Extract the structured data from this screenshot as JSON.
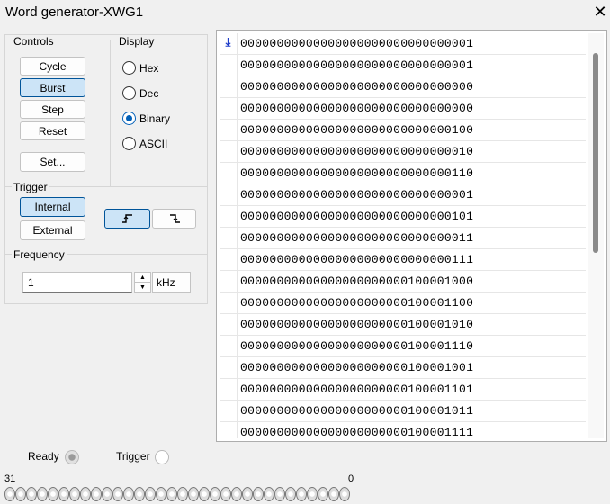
{
  "window": {
    "title": "Word generator-XWG1",
    "close_icon": "close-icon"
  },
  "controls": {
    "label": "Controls",
    "buttons": [
      {
        "label": "Cycle",
        "active": false
      },
      {
        "label": "Burst",
        "active": true
      },
      {
        "label": "Step",
        "active": false
      },
      {
        "label": "Reset",
        "active": false
      }
    ],
    "set_label": "Set..."
  },
  "display": {
    "label": "Display",
    "options": [
      {
        "label": "Hex",
        "selected": false
      },
      {
        "label": "Dec",
        "selected": false
      },
      {
        "label": "Binary",
        "selected": true
      },
      {
        "label": "ASCII",
        "selected": false
      }
    ]
  },
  "trigger": {
    "label": "Trigger",
    "internal_label": "Internal",
    "external_label": "External",
    "mode": "Internal",
    "rising_edge_icon": "rising-edge-icon",
    "falling_edge_icon": "falling-edge-icon",
    "edge": "rising"
  },
  "frequency": {
    "label": "Frequency",
    "value": "1",
    "unit": "kHz"
  },
  "words": {
    "cursor_icon": "initial-position-arrow-icon",
    "rows": [
      "00000000000000000000000000000001",
      "00000000000000000000000000000001",
      "00000000000000000000000000000000",
      "00000000000000000000000000000000",
      "00000000000000000000000000000100",
      "00000000000000000000000000000010",
      "00000000000000000000000000000110",
      "00000000000000000000000000000001",
      "00000000000000000000000000000101",
      "00000000000000000000000000000011",
      "00000000000000000000000000000111",
      "00000000000000000000000100001000",
      "00000000000000000000000100001100",
      "00000000000000000000000100001010",
      "00000000000000000000000100001110",
      "00000000000000000000000100001001",
      "00000000000000000000000100001101",
      "00000000000000000000000100001011",
      "00000000000000000000000100001111"
    ]
  },
  "status": {
    "ready_label": "Ready",
    "trigger_label": "Trigger"
  },
  "bits": {
    "msb_label": "31",
    "lsb_label": "0",
    "count": 32
  }
}
